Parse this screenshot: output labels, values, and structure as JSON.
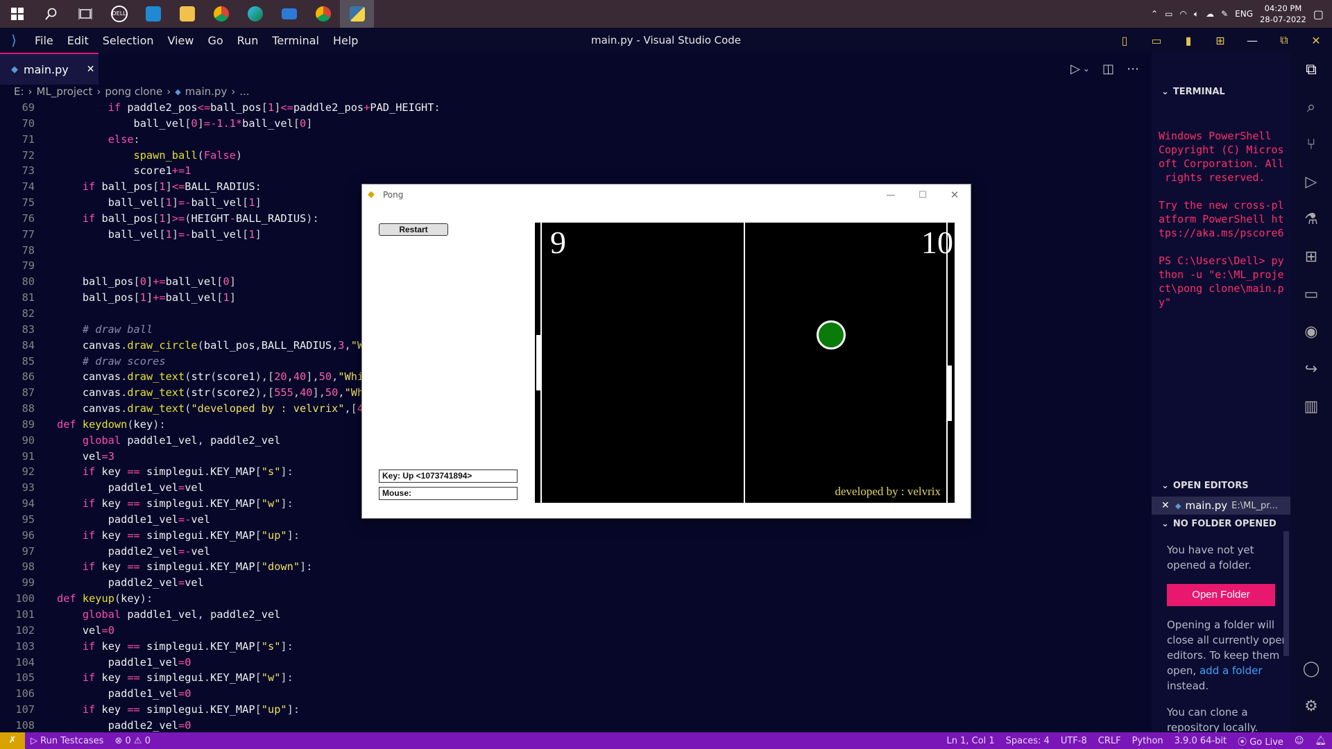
{
  "taskbar": {
    "icons": [
      "windows-start-icon",
      "search-icon",
      "task-view-icon",
      "dell-icon",
      "vscode-icon",
      "file-explorer-icon",
      "chrome-icon",
      "edge-icon",
      "mail-icon",
      "chrome-icon",
      "python-icon"
    ],
    "lang": "ENG",
    "time": "04:20 PM",
    "date": "28-07-2022"
  },
  "menubar": {
    "items": [
      "File",
      "Edit",
      "Selection",
      "View",
      "Go",
      "Run",
      "Terminal",
      "Help"
    ],
    "title": "main.py - Visual Studio Code"
  },
  "tab": {
    "label": "main.py"
  },
  "breadcrumb": [
    "E:",
    "ML_project",
    "pong clone",
    "main.py",
    "..."
  ],
  "code": {
    "lines": [
      {
        "n": "69",
        "t": "        if paddle2_pos<=ball_pos[1]<=paddle2_pos+PAD_HEIGHT:"
      },
      {
        "n": "70",
        "t": "            ball_vel[0]=-1.1*ball_vel[0]"
      },
      {
        "n": "71",
        "t": "        else:"
      },
      {
        "n": "72",
        "t": "            spawn_ball(False)"
      },
      {
        "n": "73",
        "t": "            score1+=1"
      },
      {
        "n": "74",
        "t": "    if ball_pos[1]<=BALL_RADIUS:"
      },
      {
        "n": "75",
        "t": "        ball_vel[1]=-ball_vel[1]"
      },
      {
        "n": "76",
        "t": "    if ball_pos[1]>=(HEIGHT-BALL_RADIUS):"
      },
      {
        "n": "77",
        "t": "        ball_vel[1]=-ball_vel[1]"
      },
      {
        "n": "78",
        "t": ""
      },
      {
        "n": "79",
        "t": ""
      },
      {
        "n": "80",
        "t": "    ball_pos[0]+=ball_vel[0]"
      },
      {
        "n": "81",
        "t": "    ball_pos[1]+=ball_vel[1]"
      },
      {
        "n": "82",
        "t": ""
      },
      {
        "n": "83",
        "t": "    # draw ball"
      },
      {
        "n": "84",
        "t": "    canvas.draw_circle(ball_pos,BALL_RADIUS,3,\"W"
      },
      {
        "n": "85",
        "t": "    # draw scores"
      },
      {
        "n": "86",
        "t": "    canvas.draw_text(str(score1),[20,40],50,\"Whi"
      },
      {
        "n": "87",
        "t": "    canvas.draw_text(str(score2),[555,40],50,\"Wh"
      },
      {
        "n": "88",
        "t": "    canvas.draw_text(\"developed by : velvrix\",[4"
      },
      {
        "n": "89",
        "t": "def keydown(key):"
      },
      {
        "n": "90",
        "t": "    global paddle1_vel, paddle2_vel"
      },
      {
        "n": "91",
        "t": "    vel=3"
      },
      {
        "n": "92",
        "t": "    if key == simplegui.KEY_MAP[\"s\"]:"
      },
      {
        "n": "93",
        "t": "        paddle1_vel=vel"
      },
      {
        "n": "94",
        "t": "    if key == simplegui.KEY_MAP[\"w\"]:"
      },
      {
        "n": "95",
        "t": "        paddle1_vel=-vel"
      },
      {
        "n": "96",
        "t": "    if key == simplegui.KEY_MAP[\"up\"]:"
      },
      {
        "n": "97",
        "t": "        paddle2_vel=-vel"
      },
      {
        "n": "98",
        "t": "    if key == simplegui.KEY_MAP[\"down\"]:"
      },
      {
        "n": "99",
        "t": "        paddle2_vel=vel"
      },
      {
        "n": "100",
        "t": "def keyup(key):"
      },
      {
        "n": "101",
        "t": "    global paddle1_vel, paddle2_vel"
      },
      {
        "n": "102",
        "t": "    vel=0"
      },
      {
        "n": "103",
        "t": "    if key == simplegui.KEY_MAP[\"s\"]:"
      },
      {
        "n": "104",
        "t": "        paddle1_vel=0"
      },
      {
        "n": "105",
        "t": "    if key == simplegui.KEY_MAP[\"w\"]:"
      },
      {
        "n": "106",
        "t": "        paddle1_vel=0"
      },
      {
        "n": "107",
        "t": "    if key == simplegui.KEY_MAP[\"up\"]:"
      },
      {
        "n": "108",
        "t": "        paddle2_vel=0"
      }
    ]
  },
  "right_panel": {
    "terminal_header": "TERMINAL",
    "terminal_text": "Windows PowerShell\nCopyright (C) Micros\noft Corporation. All\n rights reserved.\n\nTry the new cross-pl\natform PowerShell ht\ntps://aka.ms/pscore6\n\nPS C:\\Users\\Dell> py\nthon -u \"e:\\ML_proje\nct\\pong clone\\main.p\ny\"",
    "open_editors_header": "OPEN EDITORS",
    "open_editor_file": "main.py",
    "open_editor_path": "E:\\ML_pr...",
    "no_folder_header": "NO FOLDER OPENED",
    "no_folder_text": "You have not yet opened a folder.",
    "open_folder_button": "Open Folder",
    "opening_text_1": "Opening a folder will close all currently open editors. To keep them open,",
    "add_folder_link": "add a folder",
    "opening_text_2": "instead.",
    "clone_text": "You can clone a repository locally."
  },
  "statusbar": {
    "run_testcases": "Run Testcases",
    "problems": "0",
    "warnings": "0",
    "position": "Ln 1, Col 1",
    "spaces": "Spaces: 4",
    "encoding": "UTF-8",
    "eol": "CRLF",
    "language": "Python",
    "interpreter": "3.9.0 64-bit",
    "go_live": "Go Live"
  },
  "pong": {
    "title": "Pong",
    "restart_label": "Restart",
    "key_status": "Key: Up <1073741894>",
    "mouse_status": "Mouse:",
    "score1": "9",
    "score2": "10",
    "credit": "developed by : velvrix",
    "ball_color": "#0a7a0a"
  },
  "colors": {
    "accent": "#e8186f",
    "status_bar": "#7a16b8",
    "editor_bg": "#07072a"
  }
}
